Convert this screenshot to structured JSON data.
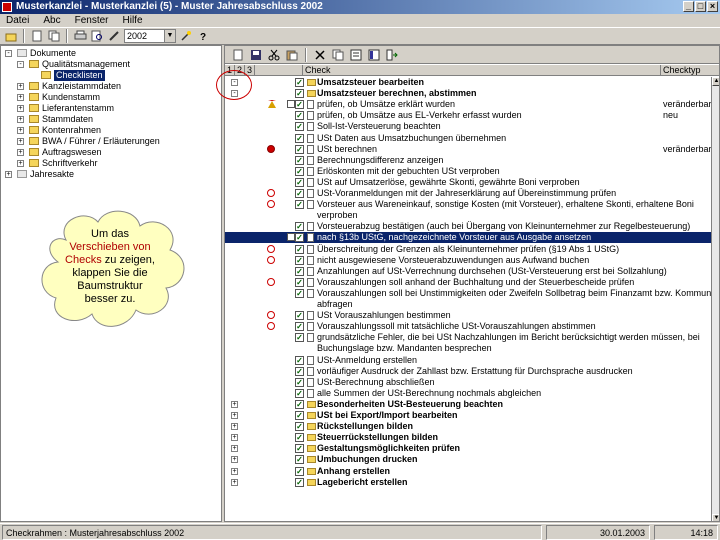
{
  "window": {
    "title": "Musterkanzlei - Musterkanzlei (5) - Muster Jahresabschluss 2002",
    "controls": {
      "minimize": "_",
      "maximize": "□",
      "close": "×"
    }
  },
  "menu": {
    "items": [
      "Datei",
      "Abc",
      "Fenster",
      "Hilfe"
    ]
  },
  "toolbar": {
    "year": "2002",
    "year_dropdown": "▼"
  },
  "tree": {
    "nodes": [
      {
        "label": "Dokumente",
        "level": 0,
        "expander": "-",
        "type": "gray"
      },
      {
        "label": "Qualitätsmanagement",
        "level": 1,
        "expander": "-",
        "type": "folder"
      },
      {
        "label": "Checklisten",
        "level": 2,
        "expander": "",
        "type": "selected"
      },
      {
        "label": "Kanzleistammdaten",
        "level": 1,
        "expander": "+",
        "type": "folder"
      },
      {
        "label": "Kundenstamm",
        "level": 1,
        "expander": "+",
        "type": "folder"
      },
      {
        "label": "Lieferantenstamm",
        "level": 1,
        "expander": "+",
        "type": "folder"
      },
      {
        "label": "Stammdaten",
        "level": 1,
        "expander": "+",
        "type": "folder"
      },
      {
        "label": "Kontenrahmen",
        "level": 1,
        "expander": "+",
        "type": "folder"
      },
      {
        "label": "BWA / Führer / Erläuterungen",
        "level": 1,
        "expander": "+",
        "type": "folder"
      },
      {
        "label": "Auftragswesen",
        "level": 1,
        "expander": "+",
        "type": "folder"
      },
      {
        "label": "Schriftverkehr",
        "level": 1,
        "expander": "+",
        "type": "folder"
      },
      {
        "label": "Jahresakte",
        "level": 0,
        "expander": "+",
        "type": "gray"
      }
    ]
  },
  "callout": {
    "line1": "Um das",
    "line2": "Verschieben von",
    "line3a": "Checks",
    "line3b": " zu zeigen,",
    "line4": "klappen Sie die",
    "line5": "Baumstruktur",
    "line6": "besser zu."
  },
  "grid": {
    "headers": {
      "c1": "1",
      "c2": "2",
      "c3": "3",
      "check": "Check",
      "checktyp": "Checktyp"
    },
    "rows": [
      {
        "text": "Umsatzsteuer bearbeiten",
        "icon": "folder",
        "bold": true,
        "check": true,
        "exp": "-",
        "extra": ""
      },
      {
        "text": "Umsatzsteuer berechnen, abstimmen",
        "icon": "folder",
        "bold": true,
        "check": true,
        "exp": "-",
        "extra": ""
      },
      {
        "text": "prüfen, ob Umsätze erklärt wurden",
        "icon": "doc",
        "status": "warn",
        "mini": true,
        "check": true,
        "extra": "veränderbar"
      },
      {
        "text": "prüfen, ob Umsätze aus EL-Verkehr erfasst wurden",
        "icon": "doc",
        "check": true,
        "extra": "neu"
      },
      {
        "text": "Soll-Ist-Versteuerung beachten",
        "icon": "doc",
        "check": true,
        "extra": ""
      },
      {
        "text": "USt Daten aus Umsatzbuchungen übernehmen",
        "icon": "doc",
        "check": true,
        "extra": ""
      },
      {
        "text": "USt berechnen",
        "icon": "doc",
        "status": "stop",
        "check": true,
        "extra": "veränderbar"
      },
      {
        "text": "Berechnungsdifferenz anzeigen",
        "icon": "doc",
        "check": true,
        "extra": ""
      },
      {
        "text": "Erlöskonten mit der gebuchten USt verproben",
        "icon": "doc",
        "check": true,
        "extra": ""
      },
      {
        "text": "USt auf Umsatzerlöse, gewährte Skonti, gewährte Boni verproben",
        "icon": "doc",
        "check": true,
        "extra": ""
      },
      {
        "text": "USt-Voranmeldungen mit der Jahreserklärung auf Übereinstimmung prüfen",
        "icon": "doc",
        "status": "ring",
        "check": true,
        "extra": ""
      },
      {
        "text": "Vorsteuer aus Wareneinkauf, sonstige Kosten (mit Vorsteuer), erhaltene Skonti, erhaltene Boni",
        "icon": "doc",
        "status": "ring",
        "check": true,
        "extra": ""
      },
      {
        "text": "verproben",
        "icon": "none",
        "cont": true,
        "extra": ""
      },
      {
        "text": "Vorsteuerabzug bestätigen (auch bei Übergang von Kleinunternehmer zur Regelbesteuerung)",
        "icon": "doc",
        "check": true,
        "extra": ""
      },
      {
        "text": "nach §13b UStG, nachgezeichnete Vorsteuer aus Ausgabe ansetzen",
        "icon": "doc",
        "mini": true,
        "check": true,
        "hl": true,
        "extra": ""
      },
      {
        "text": "Überschreitung der Grenzen als Kleinunternehmer prüfen (§19 Abs 1 UStG)",
        "icon": "doc",
        "status": "ring",
        "check": true,
        "extra": ""
      },
      {
        "text": "nicht ausgewiesene Vorsteuerabzuwendungen aus Aufwand buchen",
        "icon": "doc",
        "status": "ring",
        "check": true,
        "extra": ""
      },
      {
        "text": "Anzahlungen auf USt-Verrechnung durchsehen (USt-Versteuerung erst bei Sollzahlung)",
        "icon": "doc",
        "check": true,
        "extra": ""
      },
      {
        "text": "Vorauszahlungen soll anhand der Buchhaltung und der Steuerbescheide prüfen",
        "icon": "doc",
        "status": "ring",
        "check": true,
        "extra": ""
      },
      {
        "text": "Vorauszahlungen soll bei Unstimmigkeiten oder Zweifeln Sollbetrag beim Finanzamt bzw. Kommune",
        "icon": "doc",
        "check": true,
        "extra": ""
      },
      {
        "text": "abfragen",
        "icon": "none",
        "cont": true,
        "extra": ""
      },
      {
        "text": "USt Vorauszahlungen bestimmen",
        "icon": "doc",
        "status": "ring",
        "check": true,
        "extra": ""
      },
      {
        "text": "Vorauszahlungssoll mit tatsächliche USt-Vorauszahlungen abstimmen",
        "icon": "doc",
        "status": "ring",
        "check": true,
        "extra": ""
      },
      {
        "text": "grundsätzliche Fehler, die bei USt Nachzahlungen im Bericht berücksichtigt werden müssen, bei",
        "icon": "doc",
        "check": true,
        "extra": ""
      },
      {
        "text": "Buchungslage bzw. Mandanten besprechen",
        "icon": "none",
        "cont": true,
        "extra": ""
      },
      {
        "text": "USt-Anmeldung erstellen",
        "icon": "doc",
        "check": true,
        "extra": ""
      },
      {
        "text": "vorläufiger Ausdruck der Zahllast bzw. Erstattung für Durchsprache ausdrucken",
        "icon": "doc",
        "check": true,
        "extra": ""
      },
      {
        "text": "USt-Berechnung abschließen",
        "icon": "doc",
        "check": true,
        "extra": ""
      },
      {
        "text": "alle Summen der USt-Berechnung nochmals abgleichen",
        "icon": "doc",
        "check": true,
        "extra": ""
      },
      {
        "text": "Besonderheiten USt-Besteuerung beachten",
        "icon": "folder",
        "bold": true,
        "check": true,
        "exp": "+",
        "extra": ""
      },
      {
        "text": "USt bei Export/Import bearbeiten",
        "icon": "folder",
        "bold": true,
        "check": true,
        "exp": "+",
        "extra": ""
      },
      {
        "text": "Rückstellungen bilden",
        "icon": "folder",
        "bold": true,
        "check": true,
        "exp": "+",
        "extra": ""
      },
      {
        "text": "Steuerrückstellungen bilden",
        "icon": "folder",
        "bold": true,
        "check": true,
        "exp": "+",
        "extra": ""
      },
      {
        "text": "Gestaltungsmöglichkeiten prüfen",
        "icon": "folder",
        "bold": true,
        "check": true,
        "exp": "+",
        "extra": ""
      },
      {
        "text": "Umbuchungen drucken",
        "icon": "folder",
        "bold": true,
        "check": true,
        "exp": "+",
        "extra": ""
      },
      {
        "text": "Anhang erstellen",
        "icon": "folder",
        "bold": true,
        "check": true,
        "exp": "+",
        "extra": ""
      },
      {
        "text": "Lagebericht erstellen",
        "icon": "folder",
        "bold": true,
        "check": true,
        "exp": "+",
        "extra": ""
      }
    ]
  },
  "statusbar": {
    "left": "Checkrahmen : Musterjahresabschluss 2002",
    "date": "30.01.2003",
    "time": "14:18"
  }
}
